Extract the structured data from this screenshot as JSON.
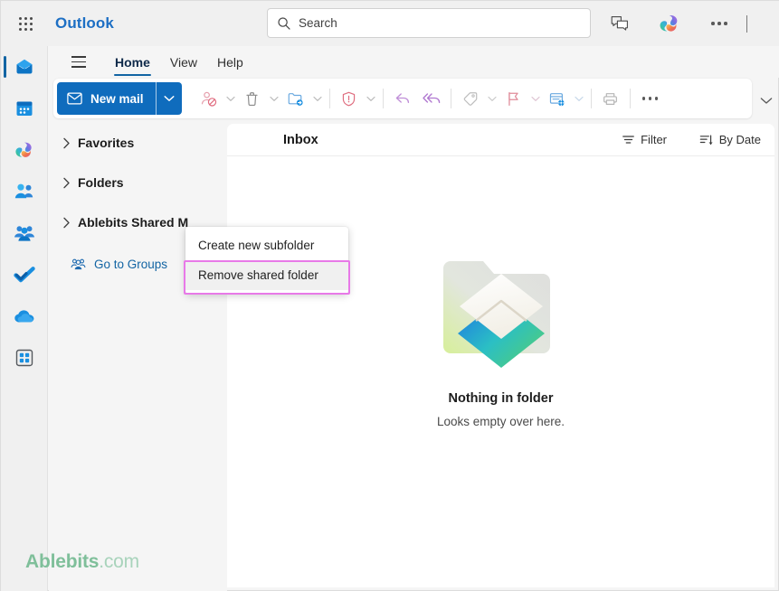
{
  "header": {
    "app_launcher": "app-launcher",
    "brand": "Outlook",
    "search": {
      "placeholder": "Search",
      "value": ""
    },
    "teams_chat": "Teams chat",
    "copilot": "Copilot",
    "more": "More options"
  },
  "rail": {
    "items": [
      {
        "name": "mail",
        "label": "Mail",
        "active": true
      },
      {
        "name": "calendar",
        "label": "Calendar",
        "active": false
      },
      {
        "name": "copilot",
        "label": "Copilot",
        "active": false
      },
      {
        "name": "people",
        "label": "People",
        "active": false
      },
      {
        "name": "groups",
        "label": "Groups",
        "active": false
      },
      {
        "name": "todo",
        "label": "To Do",
        "active": false
      },
      {
        "name": "onedrive",
        "label": "OneDrive",
        "active": false
      },
      {
        "name": "apps",
        "label": "Apps",
        "active": false
      }
    ]
  },
  "ribbon": {
    "menu_toggle": "Ribbon menu",
    "tabs": [
      {
        "label": "Home",
        "active": true
      },
      {
        "label": "View",
        "active": false
      },
      {
        "label": "Help",
        "active": false
      }
    ],
    "collapse": "Collapse ribbon"
  },
  "toolbar": {
    "new_mail_label": "New mail",
    "new_mail_caret": "New mail options",
    "items": [
      {
        "name": "block-sender",
        "label": "Block"
      },
      {
        "name": "delete",
        "label": "Delete"
      },
      {
        "name": "move-to",
        "label": "Move to"
      },
      {
        "name": "report",
        "label": "Report"
      },
      {
        "name": "reply",
        "label": "Reply"
      },
      {
        "name": "reply-all",
        "label": "Reply all"
      },
      {
        "name": "tag",
        "label": "Tag"
      },
      {
        "name": "flag",
        "label": "Flag"
      },
      {
        "name": "rules",
        "label": "Rules"
      },
      {
        "name": "print",
        "label": "Print"
      }
    ],
    "more_label": "More commands"
  },
  "folder_pane": {
    "nodes": [
      {
        "label": "Favorites",
        "expanded": false
      },
      {
        "label": "Folders",
        "expanded": false
      },
      {
        "label": "Ablebits Shared M",
        "expanded": false
      }
    ],
    "groups_link": "Go to Groups"
  },
  "list_pane": {
    "title": "Inbox",
    "filter_label": "Filter",
    "sort_label": "By Date",
    "empty": {
      "title": "Nothing in folder",
      "subtitle": "Looks empty over here."
    }
  },
  "context_menu": {
    "items": [
      {
        "label": "Create new subfolder",
        "hovered": false
      },
      {
        "label": "Remove shared folder",
        "hovered": true
      }
    ],
    "highlight_color": "#e879e8"
  },
  "watermark": {
    "bold": "Ablebits",
    "light": ".com"
  },
  "colors": {
    "accent_blue": "#0f6cbd",
    "tab_underline": "#1264a3",
    "link_blue": "#1264a3",
    "highlight_pink": "#e879e8",
    "watermark_green": "#7fbf9a"
  }
}
